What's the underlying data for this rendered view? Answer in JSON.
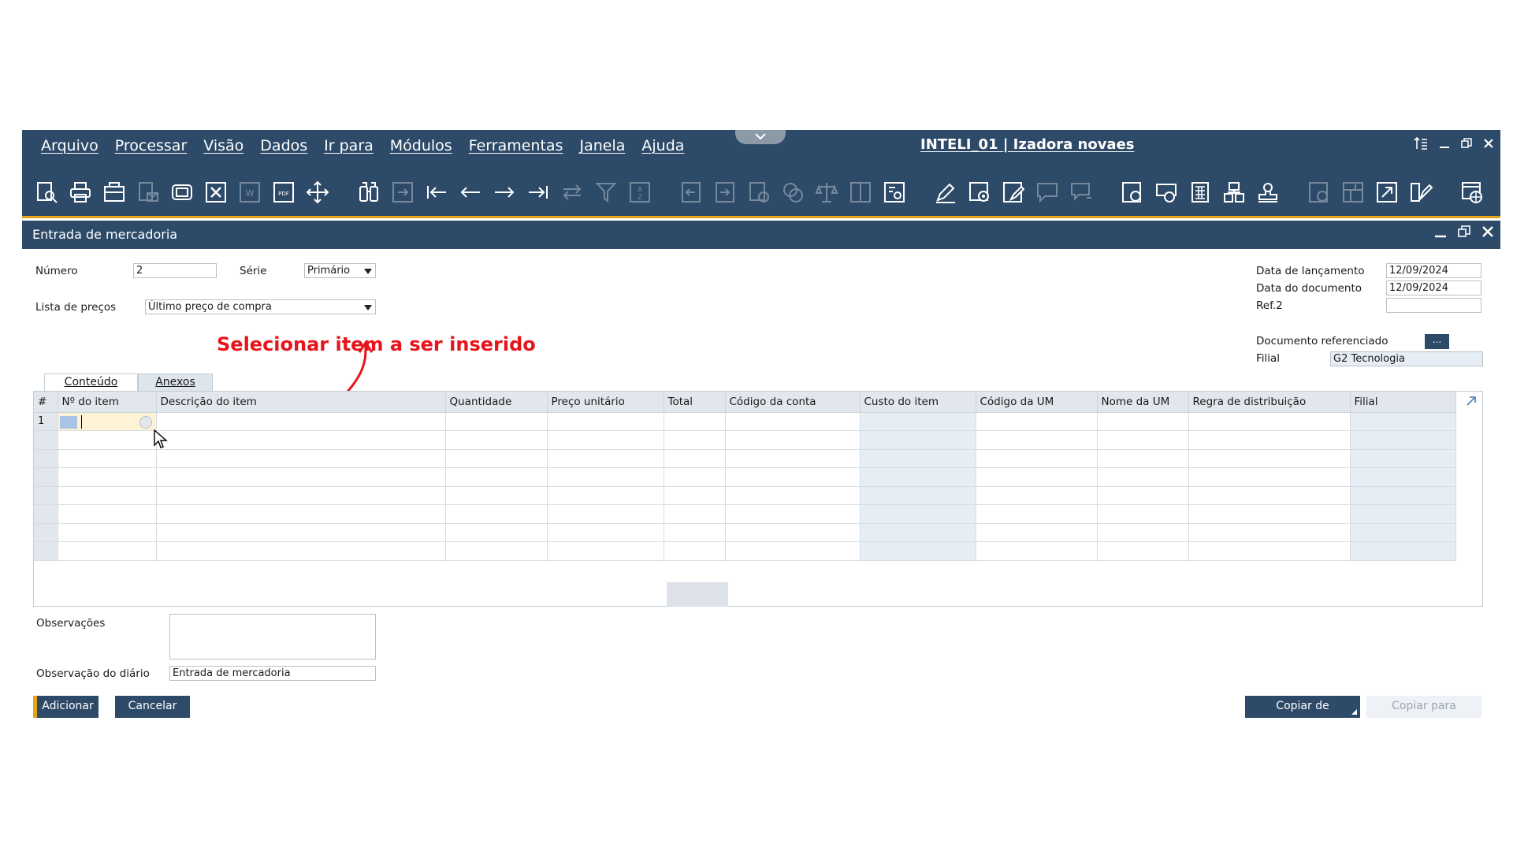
{
  "menubar": {
    "items": [
      "Arquivo",
      "Processar",
      "Visão",
      "Dados",
      "Ir para",
      "Módulos",
      "Ferramentas",
      "Janela",
      "Ajuda"
    ],
    "title": "INTELI_01 | Izadora novaes"
  },
  "toolbar": {
    "icons": [
      "preview-icon",
      "print-icon",
      "print-preview-icon",
      "email-icon",
      "export-icon",
      "excel-icon",
      "word-icon",
      "pdf-icon",
      "move-icon",
      "find-icon",
      "add-icon",
      "first-record-icon",
      "previous-record-icon",
      "next-record-icon",
      "last-record-icon",
      "refresh-icon",
      "filter-icon",
      "sort-icon",
      "base-document-icon",
      "target-document-icon",
      "payment-icon",
      "volume-icon",
      "balance-icon",
      "journal-icon",
      "transaction-report-icon",
      "edit-icon",
      "settings-icon",
      "form-settings-icon",
      "message-icon",
      "alert-icon",
      "gross-profit-icon",
      "layout-icon",
      "calculator-icon",
      "users-icon",
      "stamp-icon",
      "drag-relate-icon",
      "add-field-icon",
      "external-link-icon",
      "pen-icon",
      "web-icon",
      "help-icon"
    ]
  },
  "window": {
    "title": "Entrada de mercadoria"
  },
  "form": {
    "numero_label": "Número",
    "numero_value": "2",
    "serie_label": "Série",
    "serie_value": "Primário",
    "lista_label": "Lista de preços",
    "lista_value": "Último preço de compra",
    "data_lanc_label": "Data de lançamento",
    "data_lanc_value": "12/09/2024",
    "data_doc_label": "Data do documento",
    "data_doc_value": "12/09/2024",
    "ref2_label": "Ref.2",
    "ref2_value": "",
    "doc_ref_label": "Documento referenciado",
    "doc_ref_button": "...",
    "filial_label": "Filial",
    "filial_value": "G2 Tecnologia"
  },
  "annotation": "Selecionar item a ser inserido",
  "tabs": [
    "Conteúdo",
    "Anexos"
  ],
  "grid": {
    "columns": [
      "#",
      "Nº do item",
      "Descrição do item",
      "Quantidade",
      "Preço unitário",
      "Total",
      "Código da conta",
      "Custo do item",
      "Código da UM",
      "Nome da UM",
      "Regra de distribuição",
      "Filial"
    ],
    "first_row_number": "1"
  },
  "footer": {
    "observacoes_label": "Observações",
    "observacoes_value": "",
    "obs_diario_label": "Observação do diário",
    "obs_diario_value": "Entrada de mercadoria",
    "add_button": "Adicionar",
    "cancel_button": "Cancelar",
    "copy_from_button": "Copiar de",
    "copy_to_button": "Copiar para"
  },
  "colors": {
    "header_bg": "#2d4a68",
    "accent": "#e8a317",
    "annotation": "#e8141b",
    "shaded_column": "#e6edf5"
  }
}
